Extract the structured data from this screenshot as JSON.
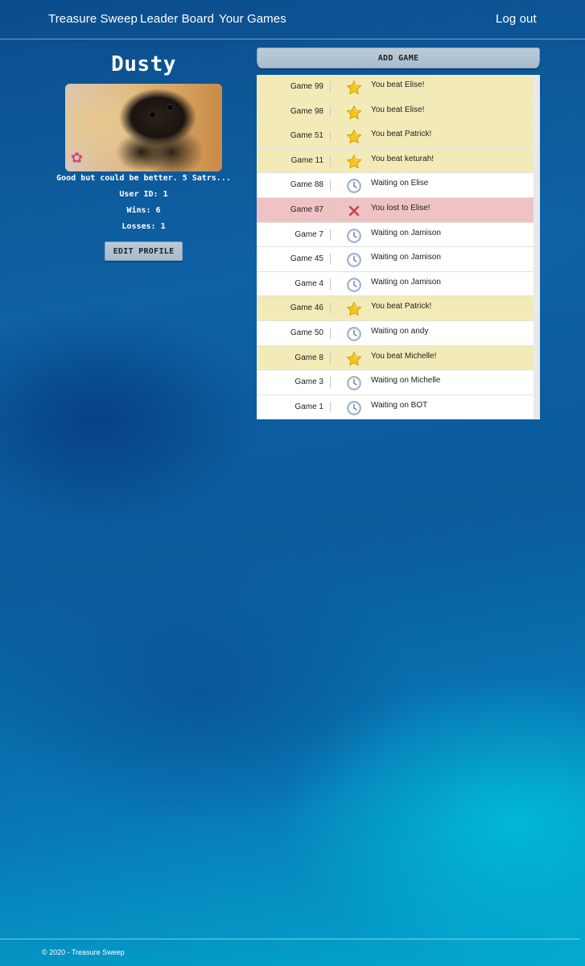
{
  "nav": {
    "brand": "Treasure Sweep",
    "leaderboard": "Leader Board",
    "your_games": "Your Games",
    "logout": "Log out"
  },
  "profile": {
    "name": "Dusty",
    "bio": "Good but could be better. 5 Satrs...",
    "user_id": "User ID: 1",
    "wins": "Wins: 6",
    "losses": "Losses: 1",
    "edit_label": "EDIT PROFILE"
  },
  "games": {
    "add_label": "ADD GAME",
    "items": [
      {
        "title": "Game 99",
        "status": "You beat Elise!",
        "state": "won",
        "icon": "star-icon"
      },
      {
        "title": "Game 98",
        "status": "You beat Elise!",
        "state": "won",
        "icon": "star-icon"
      },
      {
        "title": "Game 51",
        "status": "You beat Patrick!",
        "state": "won",
        "icon": "star-icon"
      },
      {
        "title": "Game 11",
        "status": "You beat keturah!",
        "state": "won",
        "icon": "star-icon"
      },
      {
        "title": "Game 88",
        "status": "Waiting on Elise",
        "state": "waiting",
        "icon": "clock-icon"
      },
      {
        "title": "Game 87",
        "status": "You lost to Elise!",
        "state": "lost",
        "icon": "cross-icon"
      },
      {
        "title": "Game 7",
        "status": "Waiting on Jamison",
        "state": "waiting",
        "icon": "clock-icon"
      },
      {
        "title": "Game 45",
        "status": "Waiting on Jamison",
        "state": "waiting",
        "icon": "clock-icon"
      },
      {
        "title": "Game 4",
        "status": "Waiting on Jamison",
        "state": "waiting",
        "icon": "clock-icon"
      },
      {
        "title": "Game 46",
        "status": "You beat Patrick!",
        "state": "won",
        "icon": "star-icon"
      },
      {
        "title": "Game 50",
        "status": "Waiting on andy",
        "state": "waiting",
        "icon": "clock-icon"
      },
      {
        "title": "Game 8",
        "status": "You beat Michelle!",
        "state": "won",
        "icon": "star-icon"
      },
      {
        "title": "Game 3",
        "status": "Waiting on Michelle",
        "state": "waiting",
        "icon": "clock-icon"
      },
      {
        "title": "Game 1",
        "status": "Waiting on BOT",
        "state": "waiting",
        "icon": "clock-icon"
      }
    ]
  },
  "footer": {
    "copyright": "© 2020 - Treasure Sweep"
  },
  "colors": {
    "won_row": "#f2ebb8",
    "lost_row": "#efc3c4",
    "waiting_row": "#ffffff",
    "button": "#b3c5d5"
  }
}
